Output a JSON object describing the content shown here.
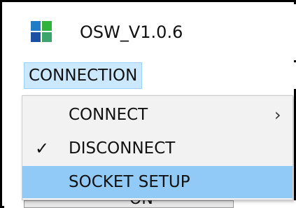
{
  "window": {
    "title": "OSW_V1.0.6",
    "icon": "app-tiles-icon",
    "icon_colors": [
      "#1f7cc7",
      "#2fb33c",
      "#3ca56c",
      "#1d4fa3"
    ]
  },
  "menubar": {
    "items": [
      {
        "label": "CONNECTION",
        "state": "open"
      }
    ]
  },
  "dropdown": {
    "items": [
      {
        "label": "CONNECT",
        "has_submenu": true,
        "submenu_icon": "chevron-right-icon",
        "checked": false
      },
      {
        "label": "DISCONNECT",
        "has_submenu": false,
        "checked": true,
        "check_icon": "check-icon"
      },
      {
        "label": "SOCKET SETUP",
        "has_submenu": false,
        "checked": false,
        "highlighted": true
      }
    ],
    "highlight_color": "#91c9f7"
  },
  "background": {
    "partial_button_label": "ON"
  },
  "glyphs": {
    "check": "✓",
    "chevron": "›"
  }
}
